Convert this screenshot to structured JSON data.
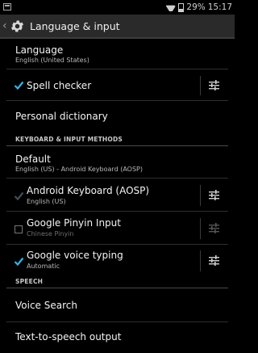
{
  "status_bar": {
    "battery": "29%",
    "time": "15:17"
  },
  "action_bar": {
    "title": "Language & input"
  },
  "language": {
    "title": "Language",
    "subtitle": "English (United States)"
  },
  "spell_checker": {
    "title": "Spell checker",
    "checked": true
  },
  "personal_dictionary": {
    "title": "Personal dictionary"
  },
  "keyboard_section": {
    "header": "KEYBOARD & INPUT METHODS",
    "default": {
      "title": "Default",
      "subtitle": "English (US) - Android Keyboard (AOSP)"
    },
    "methods": [
      {
        "title": "Android Keyboard (AOSP)",
        "subtitle": "English (US)",
        "checked": true,
        "enabled": false
      },
      {
        "title": "Google Pinyin Input",
        "subtitle": "Chinese Pinyin",
        "checked": false,
        "enabled": true
      },
      {
        "title": "Google voice typing",
        "subtitle": "Automatic",
        "checked": true,
        "enabled": true
      }
    ]
  },
  "speech_section": {
    "header": "SPEECH",
    "items": [
      {
        "title": "Voice Search"
      },
      {
        "title": "Text-to-speech output"
      }
    ]
  },
  "colors": {
    "accent": "#33b5e5",
    "background": "#000000",
    "action_bar": "#2a2a2a"
  },
  "icons": [
    "notification-icon",
    "wifi-icon",
    "battery-icon",
    "back-icon",
    "settings-gear-icon",
    "checkbox-icon",
    "tune-settings-icon"
  ]
}
